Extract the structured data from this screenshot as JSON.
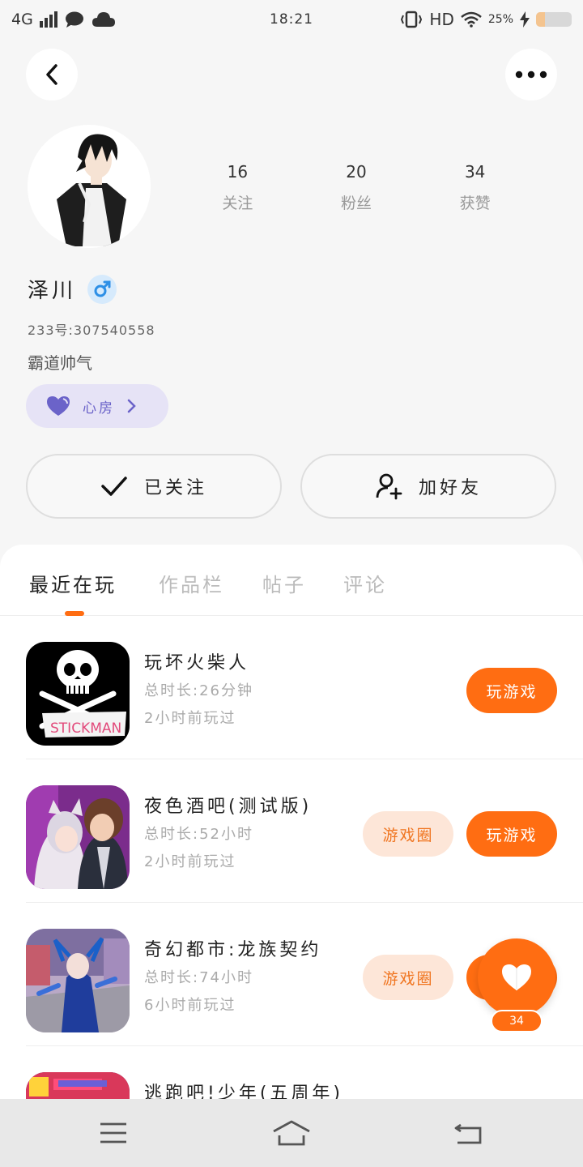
{
  "status_bar": {
    "network": "4G",
    "time": "18:21",
    "hd": "HD",
    "battery": "25%",
    "battery_level": 0.25
  },
  "profile": {
    "following_count": "16",
    "following_label": "关注",
    "fans_count": "20",
    "fans_label": "粉丝",
    "likes_count": "34",
    "likes_label": "获赞",
    "name": "泽川",
    "uid": "233号:307540558",
    "signature": "霸道帅气",
    "heart_room_label": "心房"
  },
  "actions": {
    "follow_label": "已关注",
    "add_friend_label": "加好友"
  },
  "tabs": [
    "最近在玩",
    "作品栏",
    "帖子",
    "评论"
  ],
  "games": [
    {
      "title": "玩坏火柴人",
      "duration": "总时长:26分钟",
      "last_played": "2小时前玩过",
      "play_label": "玩游戏",
      "circle_label": ""
    },
    {
      "title": "夜色酒吧(测试版)",
      "duration": "总时长:52小时",
      "last_played": "2小时前玩过",
      "play_label": "玩游戏",
      "circle_label": "游戏圈"
    },
    {
      "title": "奇幻都市:龙族契约",
      "duration": "总时长:74小时",
      "last_played": "6小时前玩过",
      "play_label": "玩游戏",
      "circle_label": "游戏圈"
    },
    {
      "title": "逃跑吧!少年(五周年)",
      "duration": "",
      "last_played": "",
      "play_label": "",
      "circle_label": ""
    }
  ],
  "like_fab": {
    "count": "34"
  },
  "colors": {
    "accent": "#ff6d12",
    "accent_light": "#fde6d8",
    "heart_room": "#6b63c9"
  },
  "icons": {
    "back": "chevron-left-icon",
    "more": "more-dots-icon",
    "gender": "male-icon",
    "heart_room": "heart-icon",
    "follow": "check-icon",
    "add_friend": "add-user-icon",
    "like": "heart-icon",
    "nav": [
      "menu-icon",
      "home-icon",
      "back-icon"
    ]
  }
}
